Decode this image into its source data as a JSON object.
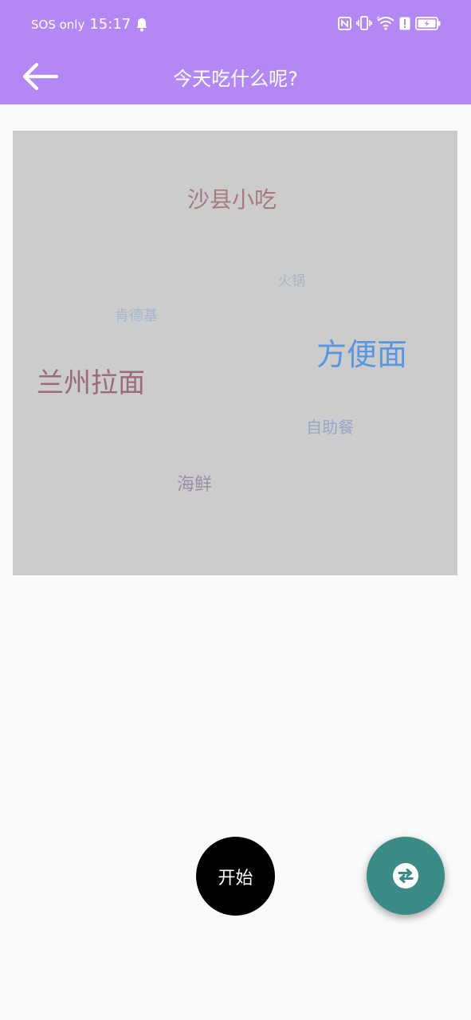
{
  "status_bar": {
    "carrier": "SOS only",
    "time": "15:17",
    "icons": [
      "bell-icon",
      "nfc-icon",
      "vibrate-icon",
      "wifi-6-icon",
      "alert-icon",
      "battery-charging-icon"
    ]
  },
  "app_bar": {
    "title": "今天吃什么呢?",
    "back_icon": "arrow-left-icon"
  },
  "word_cloud": {
    "words": [
      {
        "text": "沙县小吃",
        "color": "#a87a7e"
      },
      {
        "text": "火锅",
        "color": "#aab4c4"
      },
      {
        "text": "肯德基",
        "color": "#a5b8cf"
      },
      {
        "text": "方便面",
        "color": "#5a95e0"
      },
      {
        "text": "兰州拉面",
        "color": "#9b6b7c"
      },
      {
        "text": "自助餐",
        "color": "#97a6c4"
      },
      {
        "text": "海鲜",
        "color": "#9c8ea6"
      }
    ]
  },
  "buttons": {
    "start_label": "开始",
    "swap_icon": "swap-arrows-icon"
  },
  "colors": {
    "app_bar": "#b388f5",
    "word_cloud_bg": "#cccccc",
    "page_bg": "#fafafa",
    "start_button": "#000000",
    "swap_button": "#3a8a85"
  }
}
